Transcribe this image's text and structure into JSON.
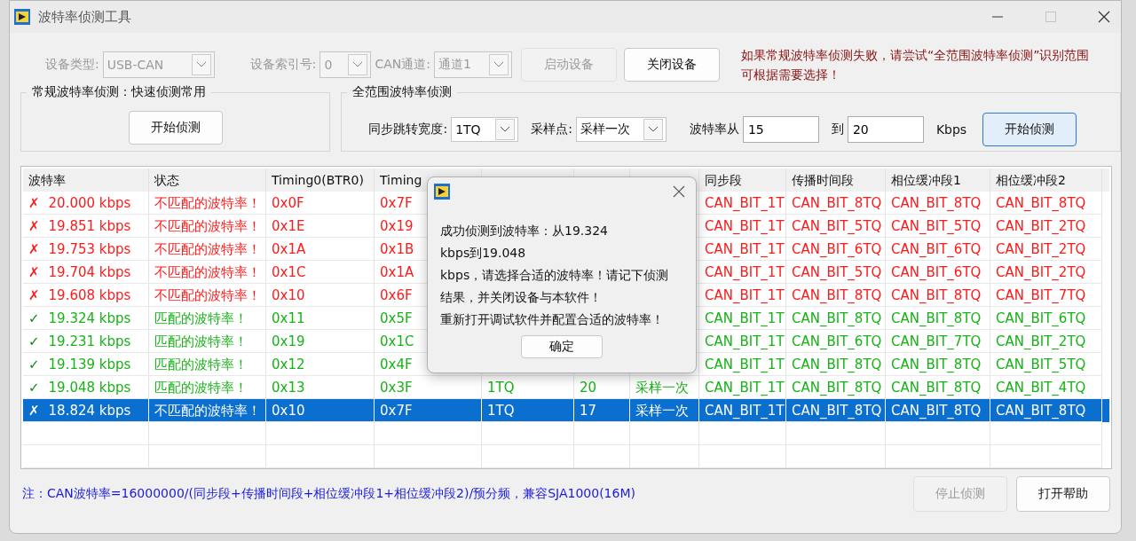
{
  "window": {
    "title": "波特率侦测工具"
  },
  "device": {
    "fields": [
      {
        "label": "设备类型:",
        "value": "USB-CAN",
        "disabled": true
      },
      {
        "label": "设备索引号:",
        "value": "0",
        "disabled": true
      },
      {
        "label": "CAN通道:",
        "value": "通道1",
        "disabled": true
      }
    ],
    "buttons": [
      {
        "label": "启动设备",
        "disabled": true
      },
      {
        "label": "关闭设备",
        "disabled": false
      }
    ],
    "notice": "如果常规波特率侦测失败，请尝试“全范围波特率侦测”识别范围可根据需要选择！"
  },
  "quick_group": {
    "title": "常规波特率侦测：快速侦测常用",
    "button": {
      "label": "开始侦测",
      "focused": false
    }
  },
  "full_group": {
    "title": "全范围波特率侦测",
    "sjw": {
      "label": "同步跳转宽度:",
      "value": "1TQ"
    },
    "sample": {
      "label": "采样点:",
      "value": "采样一次"
    },
    "from": {
      "label": "波特率从",
      "value": "15"
    },
    "to": {
      "label": "到",
      "value": "20"
    },
    "unit": "Kbps",
    "button": {
      "label": "开始侦测",
      "focused": true
    }
  },
  "table": {
    "columns": [
      "波特率",
      "状态",
      "Timing0(BTR0)",
      "Timing",
      null,
      null,
      null,
      "同步段",
      "传播时间段",
      "相位缓冲段1",
      "相位缓冲段2"
    ],
    "rows": [
      {
        "match": false,
        "selected": false,
        "mark": "✗",
        "cells": [
          "20.000 kbps",
          "不匹配的波特率！",
          "0x0F",
          "0x7F",
          null,
          null,
          null,
          "CAN_BIT_1T",
          "CAN_BIT_8TQ",
          "CAN_BIT_8TQ",
          "CAN_BIT_8TQ"
        ]
      },
      {
        "match": false,
        "selected": false,
        "mark": "✗",
        "cells": [
          "19.851 kbps",
          "不匹配的波特率！",
          "0x1E",
          "0x19",
          null,
          null,
          null,
          "CAN_BIT_1T",
          "CAN_BIT_5TQ",
          "CAN_BIT_5TQ",
          "CAN_BIT_2TQ"
        ]
      },
      {
        "match": false,
        "selected": false,
        "mark": "✗",
        "cells": [
          "19.753 kbps",
          "不匹配的波特率！",
          "0x1A",
          "0x1B",
          null,
          null,
          null,
          "CAN_BIT_1T",
          "CAN_BIT_6TQ",
          "CAN_BIT_6TQ",
          "CAN_BIT_2TQ"
        ]
      },
      {
        "match": false,
        "selected": false,
        "mark": "✗",
        "cells": [
          "19.704 kbps",
          "不匹配的波特率！",
          "0x1C",
          "0x1A",
          null,
          null,
          null,
          "CAN_BIT_1T",
          "CAN_BIT_5TQ",
          "CAN_BIT_6TQ",
          "CAN_BIT_2TQ"
        ]
      },
      {
        "match": false,
        "selected": false,
        "mark": "✗",
        "cells": [
          "19.608 kbps",
          "不匹配的波特率！",
          "0x10",
          "0x6F",
          null,
          null,
          null,
          "CAN_BIT_1T",
          "CAN_BIT_8TQ",
          "CAN_BIT_8TQ",
          "CAN_BIT_7TQ"
        ]
      },
      {
        "match": true,
        "selected": false,
        "mark": "✓",
        "cells": [
          "19.324 kbps",
          "匹配的波特率！",
          "0x11",
          "0x5F",
          null,
          null,
          null,
          "CAN_BIT_1T",
          "CAN_BIT_8TQ",
          "CAN_BIT_8TQ",
          "CAN_BIT_6TQ"
        ]
      },
      {
        "match": true,
        "selected": false,
        "mark": "✓",
        "cells": [
          "19.231 kbps",
          "匹配的波特率！",
          "0x19",
          "0x1C",
          null,
          null,
          null,
          "CAN_BIT_1T",
          "CAN_BIT_6TQ",
          "CAN_BIT_7TQ",
          "CAN_BIT_2TQ"
        ]
      },
      {
        "match": true,
        "selected": false,
        "mark": "✓",
        "cells": [
          "19.139 kbps",
          "匹配的波特率！",
          "0x12",
          "0x4F",
          null,
          null,
          null,
          "CAN_BIT_1T",
          "CAN_BIT_8TQ",
          "CAN_BIT_8TQ",
          "CAN_BIT_5TQ"
        ]
      },
      {
        "match": true,
        "selected": false,
        "mark": "✓",
        "cells": [
          "19.048 kbps",
          "匹配的波特率！",
          "0x13",
          "0x3F",
          "1TQ",
          "20",
          "采样一次",
          "CAN_BIT_1T",
          "CAN_BIT_8TQ",
          "CAN_BIT_8TQ",
          "CAN_BIT_4TQ"
        ]
      },
      {
        "selected": true,
        "mark": "✗",
        "cells": [
          "18.824 kbps",
          "不匹配的波特率！",
          "0x10",
          "0x7F",
          "1TQ",
          "17",
          "采样一次",
          "CAN_BIT_1T",
          "CAN_BIT_8TQ",
          "CAN_BIT_8TQ",
          "CAN_BIT_8TQ"
        ]
      }
    ]
  },
  "dialog": {
    "lines": [
      "成功侦测到波特率：从19.324",
      "kbps到19.048",
      "kbps，请选择合适的波特率！请记下侦测",
      "结果，并关闭设备与本软件！",
      "重新打开调试软件并配置合适的波特率！"
    ],
    "button": "确定"
  },
  "footer": {
    "note": "注：CAN波特率=16000000/(同步段+传播时间段+相位缓冲段1+相位缓冲段2)/预分频，兼容SJA1000(16M)",
    "buttons": [
      {
        "label": "停止侦测",
        "disabled": true
      },
      {
        "label": "打开帮助",
        "disabled": false
      }
    ]
  }
}
